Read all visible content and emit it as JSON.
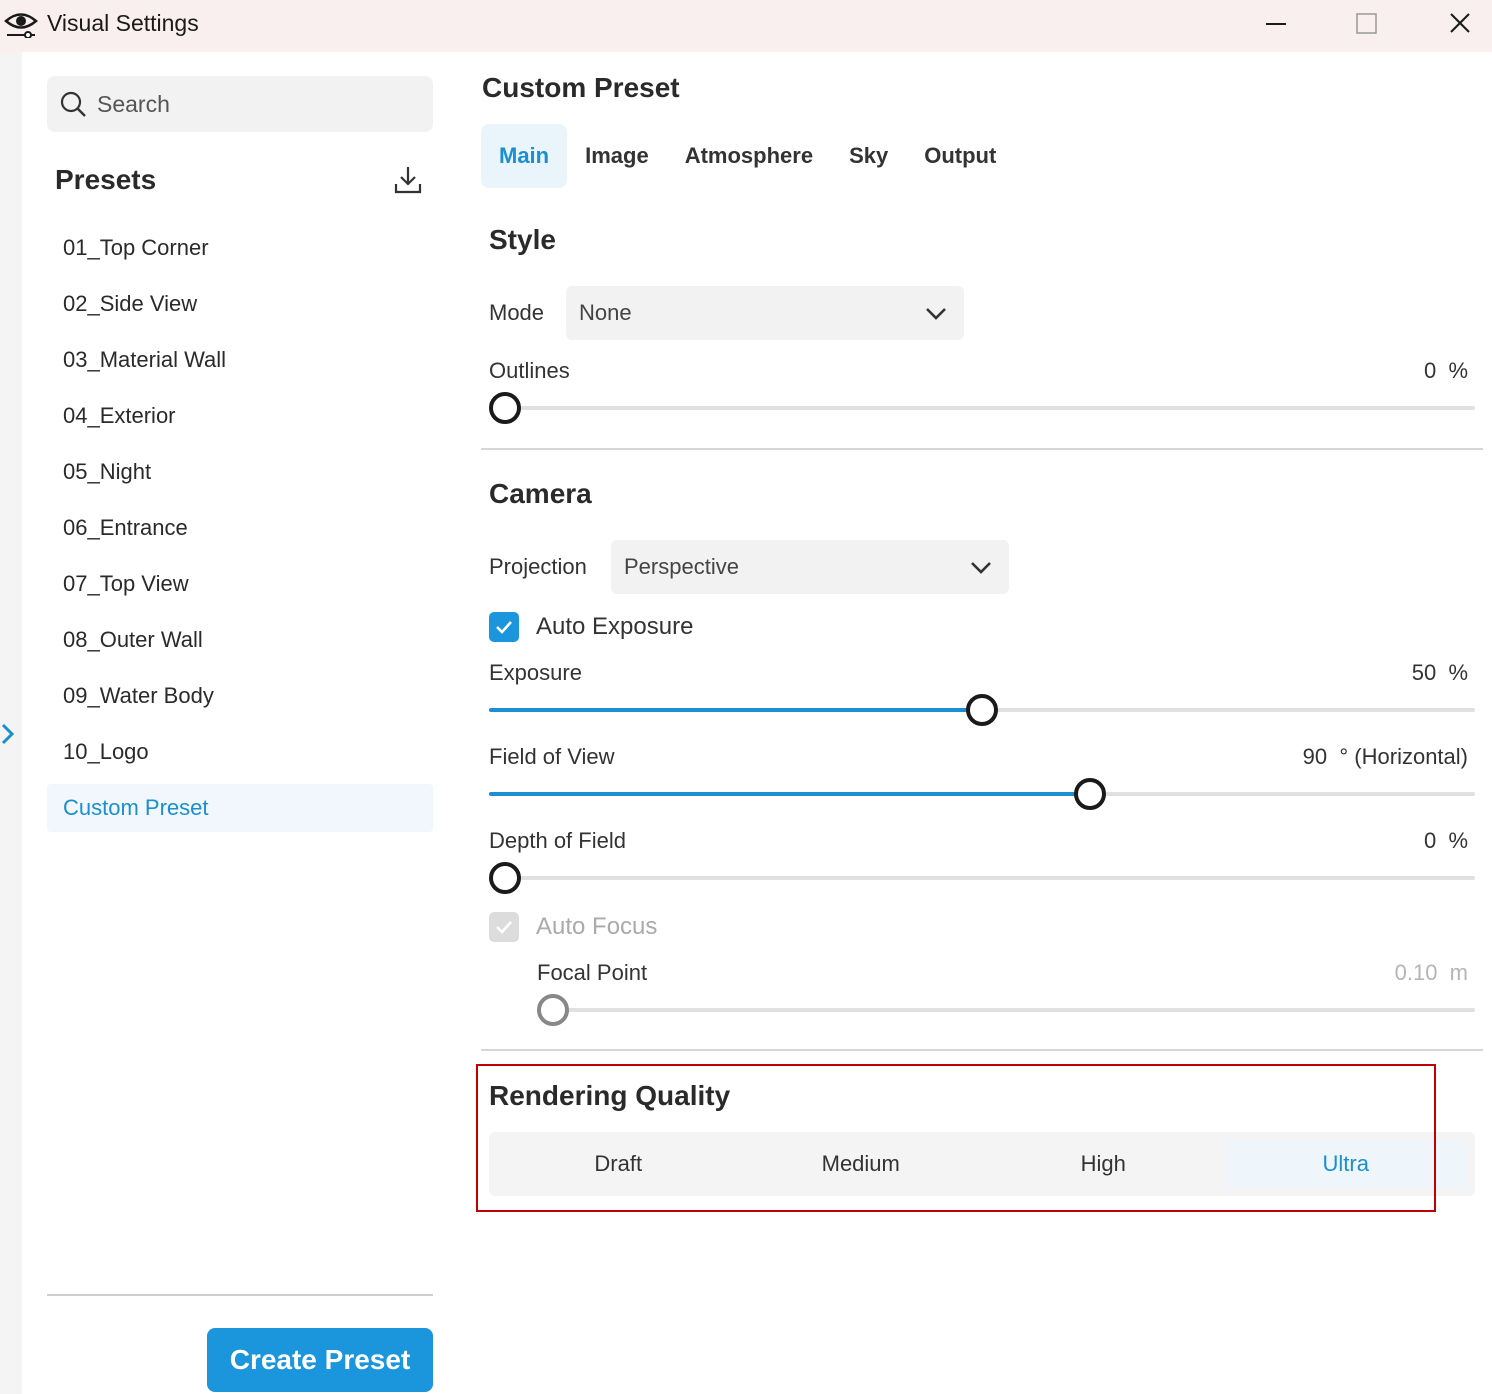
{
  "window": {
    "title": "Visual Settings",
    "app_icon": "eye-icon",
    "controls": [
      "minimize-icon",
      "maximize-icon",
      "close-icon"
    ]
  },
  "sidebar": {
    "search_placeholder": "Search",
    "presets_title": "Presets",
    "download_icon": "download-icon",
    "items": [
      {
        "label": "01_Top Corner",
        "active": false
      },
      {
        "label": "02_Side View",
        "active": false
      },
      {
        "label": "03_Material Wall",
        "active": false
      },
      {
        "label": "04_Exterior",
        "active": false
      },
      {
        "label": "05_Night",
        "active": false
      },
      {
        "label": "06_Entrance",
        "active": false
      },
      {
        "label": "07_Top View",
        "active": false
      },
      {
        "label": "08_Outer Wall",
        "active": false
      },
      {
        "label": "09_Water Body",
        "active": false
      },
      {
        "label": "10_Logo",
        "active": false
      },
      {
        "label": "Custom Preset",
        "active": true
      }
    ],
    "create_button": "Create Preset"
  },
  "main": {
    "title": "Custom Preset",
    "tabs": [
      {
        "label": "Main",
        "active": true
      },
      {
        "label": "Image",
        "active": false
      },
      {
        "label": "Atmosphere",
        "active": false
      },
      {
        "label": "Sky",
        "active": false
      },
      {
        "label": "Output",
        "active": false
      }
    ],
    "style": {
      "title": "Style",
      "mode_label": "Mode",
      "mode_value": "None",
      "outlines_label": "Outlines",
      "outlines_value": "0",
      "outlines_unit": "%",
      "outlines_level": 0
    },
    "camera": {
      "title": "Camera",
      "projection_label": "Projection",
      "projection_value": "Perspective",
      "auto_exposure_label": "Auto Exposure",
      "auto_exposure_checked": true,
      "exposure_label": "Exposure",
      "exposure_value": "50",
      "exposure_unit": "%",
      "exposure_level": 0.5,
      "fov_label": "Field of View",
      "fov_value": "90",
      "fov_unit": "° (Horizontal)",
      "fov_level": 0.61,
      "dof_label": "Depth of Field",
      "dof_value": "0",
      "dof_unit": "%",
      "dof_level": 0,
      "auto_focus_label": "Auto Focus",
      "auto_focus_checked": true,
      "auto_focus_disabled": true,
      "focal_label": "Focal Point",
      "focal_value": "0.10",
      "focal_unit": "m",
      "focal_level": 0
    },
    "quality": {
      "title": "Rendering Quality",
      "options": [
        {
          "label": "Draft",
          "active": false
        },
        {
          "label": "Medium",
          "active": false
        },
        {
          "label": "High",
          "active": false
        },
        {
          "label": "Ultra",
          "active": true
        }
      ]
    }
  },
  "colors": {
    "accent": "#1b95dc",
    "titlebar": "#f9efee",
    "highlight": "#c00000"
  }
}
